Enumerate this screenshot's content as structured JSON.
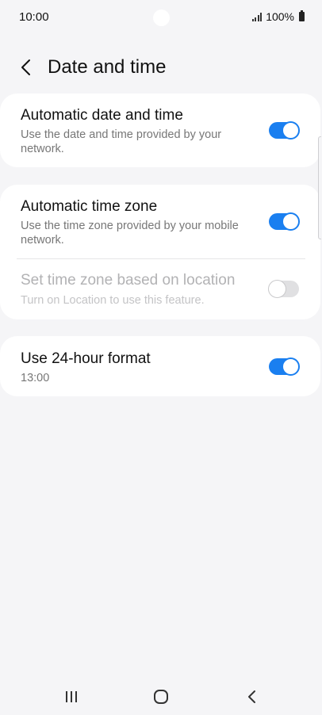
{
  "status_bar": {
    "time": "10:00",
    "battery_text": "100%"
  },
  "header": {
    "title": "Date and time"
  },
  "settings": {
    "automatic_date_time": {
      "title": "Automatic date and time",
      "description": "Use the date and time provided by your network.",
      "enabled": true
    },
    "automatic_time_zone": {
      "title": "Automatic time zone",
      "description": "Use the time zone provided by your mobile network.",
      "enabled": true
    },
    "location_time_zone": {
      "title": "Set time zone based on location",
      "description": "Turn on Location to use this feature.",
      "enabled": false,
      "disabled": true
    },
    "use_24_hour": {
      "title": "Use 24-hour format",
      "description": "13:00",
      "enabled": true
    }
  },
  "colors": {
    "accent": "#1a7ff0",
    "background": "#f5f5f7",
    "card": "#ffffff"
  },
  "icons": {
    "back": "chevron-left-icon",
    "nav_recents": "recents-icon",
    "nav_home": "home-icon",
    "nav_back": "back-icon"
  }
}
